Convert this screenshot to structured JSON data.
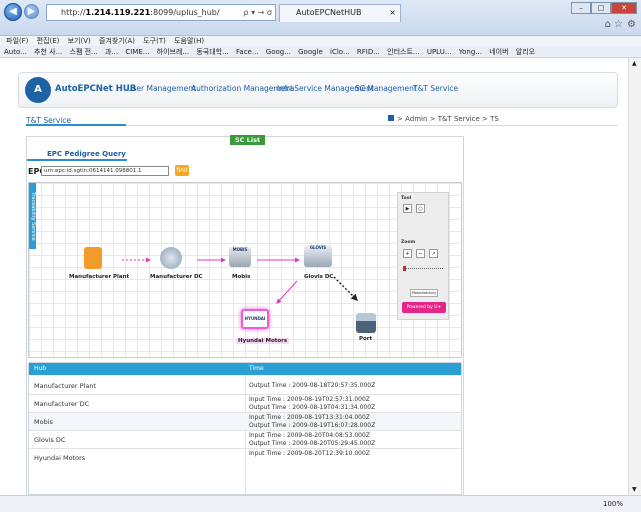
{
  "browser": {
    "url_prefix": "http://",
    "url_host": "1.214.119.221",
    "url_rest": ":8099/uplus_hub/",
    "search_symbols": "ρ ▾ → σ",
    "tab_title": "AutoEPCNetHUB",
    "tab_close": "×",
    "menu": [
      "파일(F)",
      "편집(E)",
      "보기(V)",
      "즐겨찾기(A)",
      "도구(T)",
      "도움말(H)"
    ],
    "favorites": [
      "Auto...",
      "추천 사...",
      "스팸 전...",
      "과...",
      "CIME...",
      "하이브레...",
      "동국대학...",
      "Face...",
      "Goog...",
      "Google",
      "iClo...",
      "RFID...",
      "인터스트...",
      "UPLU...",
      "Yong...",
      "네이버",
      "알리오"
    ],
    "zoom": "100%"
  },
  "header": {
    "logo_text": "AutoEPCNet HUB",
    "nav": [
      "User Management",
      "Authorization Management",
      "InfraService Management",
      "SC Management",
      "T&T Service"
    ]
  },
  "service": {
    "title": "T&T Service",
    "breadcrumb": "> Admin > T&T Service > TS"
  },
  "panel": {
    "sc_list": "SC List",
    "tab": "EPC Pedigree Query",
    "epc_label": "EPC",
    "epc_value": "urn:epc:id:sgtin:0614141.098801.1",
    "find": "find",
    "side_tab": "Traceability Service"
  },
  "graph": {
    "nodes": [
      "Manufacturer Plant",
      "Manufacturer DC",
      "Mobis",
      "Glovis DC",
      "Hyundai Motors",
      "Port"
    ],
    "tool": "Tool",
    "zoom": "Zoom",
    "metadata": "Metadirectory",
    "powered": "Powered by U+",
    "mobis_icon": "MOBIS",
    "glovis_icon": "GLOVIS",
    "hyundai_icon": "HYUNDAI"
  },
  "table": {
    "headers": [
      "Hub",
      "Time"
    ],
    "rows": [
      {
        "hub": "Manufacturer Plant",
        "time1": "",
        "time2": "Output Time : 2009-08-18T20:57:35.000Z"
      },
      {
        "hub": "Manufacturer DC",
        "time1": "Input Time : 2009-08-19T02:57:31.000Z",
        "time2": "Output Time : 2009-08-19T04:31:34.000Z"
      },
      {
        "hub": "Mobis",
        "time1": "Input Time : 2009-08-19T13:31:04.000Z",
        "time2": "Output Time : 2009-08-19T16:07:28.000Z"
      },
      {
        "hub": "Glovis DC",
        "time1": "Input Time : 2009-08-20T04:08:53.000Z",
        "time2": "Output Time : 2009-08-20T05:29:45.000Z"
      },
      {
        "hub": "Hyundai Motors",
        "time1": "Input Time : 2009-08-20T12:39:10.000Z",
        "time2": ""
      }
    ]
  }
}
